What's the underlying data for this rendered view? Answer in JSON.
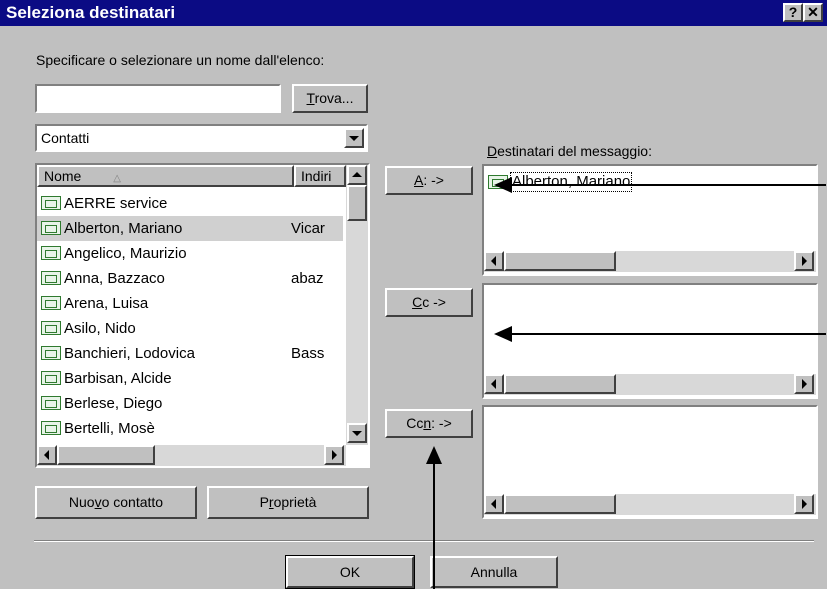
{
  "window": {
    "title": "Seleziona destinatari",
    "help_glyph": "?",
    "close_glyph": "✕"
  },
  "instruction": "Specificare o selezionare un nome dall'elenco:",
  "search": {
    "value": "",
    "button_pre": "",
    "button_u": "T",
    "button_post": "rova..."
  },
  "address_book": {
    "selected": "Contatti"
  },
  "list": {
    "headers": [
      "Nome",
      "Indiri"
    ],
    "rows": [
      {
        "name": "AERRE service",
        "address": ""
      },
      {
        "name": "Alberton, Mariano",
        "address": "Vicar",
        "selected": true
      },
      {
        "name": "Angelico, Maurizio",
        "address": ""
      },
      {
        "name": "Anna, Bazzaco",
        "address": "abaz"
      },
      {
        "name": "Arena, Luisa",
        "address": ""
      },
      {
        "name": "Asilo, Nido",
        "address": ""
      },
      {
        "name": "Banchieri, Lodovica",
        "address": "Bass"
      },
      {
        "name": "Barbisan, Alcide",
        "address": ""
      },
      {
        "name": "Berlese, Diego",
        "address": ""
      },
      {
        "name": "Bertelli, Mosè",
        "address": ""
      }
    ]
  },
  "buttons": {
    "to": {
      "u": "A",
      "rest": ": ->"
    },
    "cc": {
      "u": "C",
      "rest": "c ->"
    },
    "bcc": {
      "pre": "Cc",
      "u": "n",
      "rest": ": ->"
    },
    "new_contact": {
      "pre": "Nuo",
      "u": "v",
      "rest": "o contatto"
    },
    "properties": {
      "pre": "P",
      "u": "r",
      "rest": "oprietà"
    },
    "ok": "OK",
    "cancel": "Annulla"
  },
  "recipients": {
    "label_u": "D",
    "label_rest": "estinatari del messaggio:",
    "to_list": [
      "Alberton, Mariano"
    ],
    "cc_list": [],
    "bcc_list": []
  },
  "colors": {
    "titlebar": "#0b0b84",
    "face": "#c0c0c0",
    "selection": "#d0d0d0"
  },
  "icons": {
    "contact": "contact-card-icon",
    "sort": "sort-ascending-icon"
  }
}
